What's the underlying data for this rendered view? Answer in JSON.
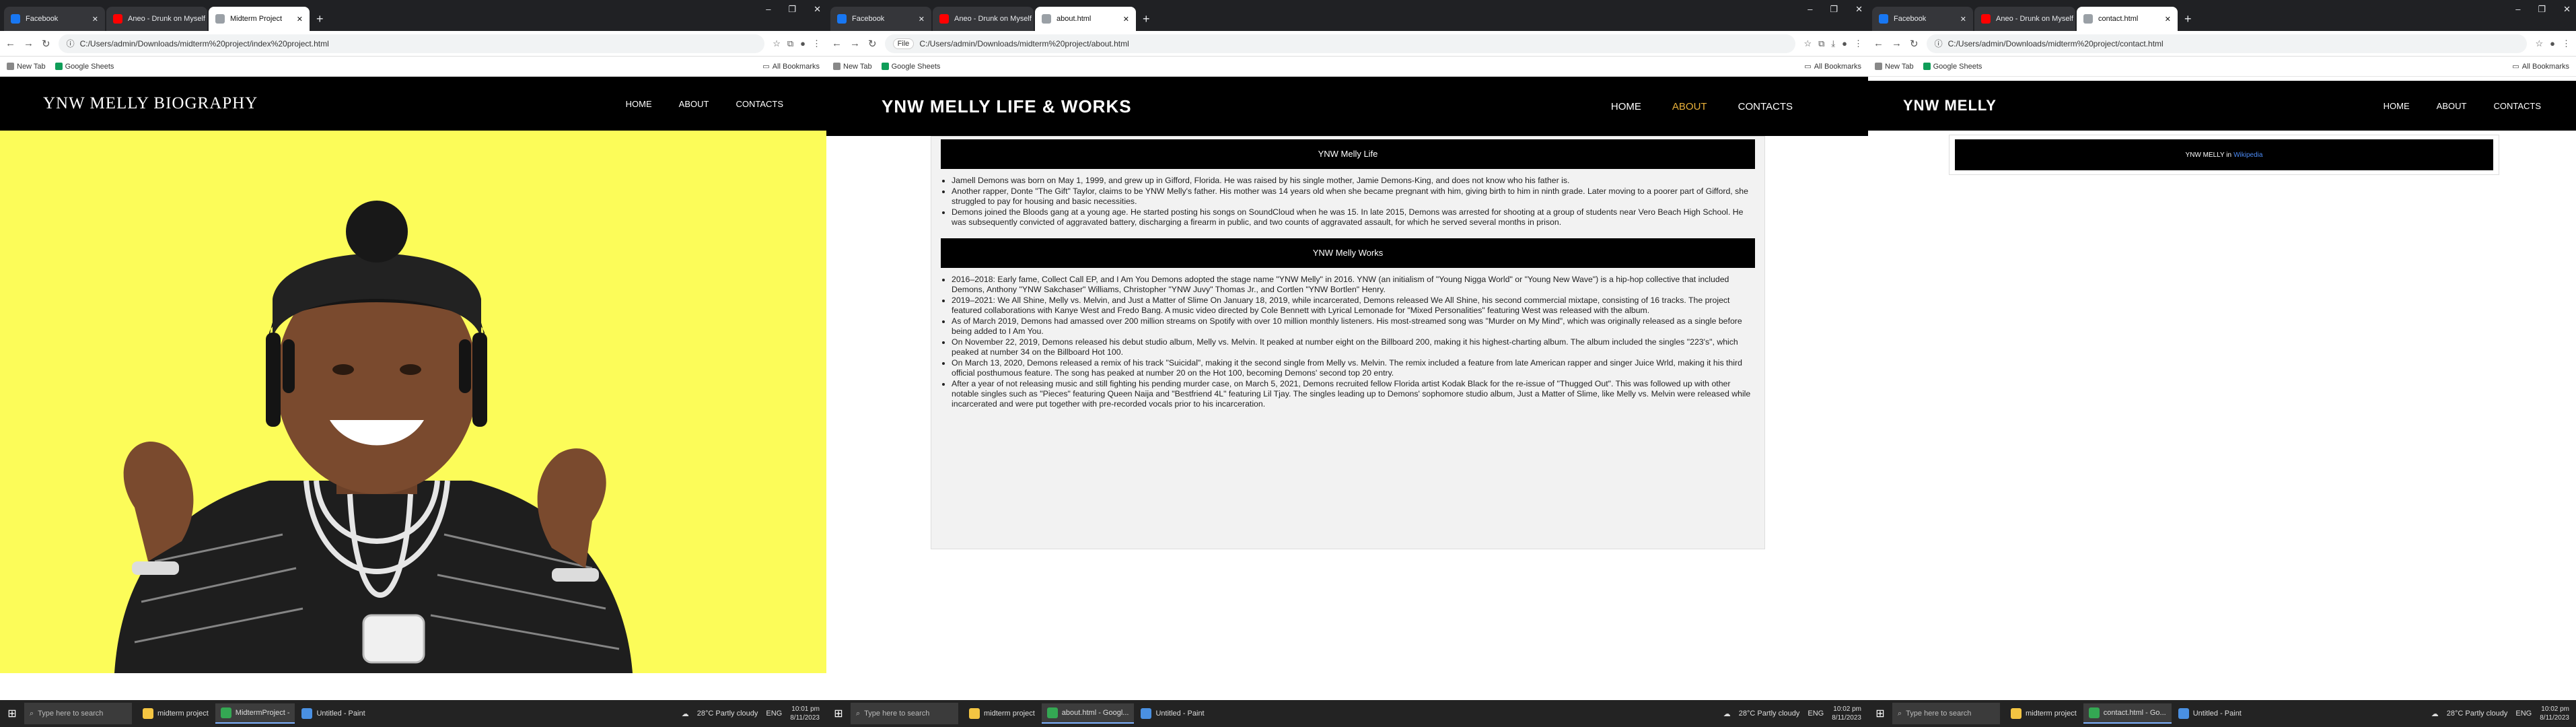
{
  "windows": [
    {
      "tabs": [
        {
          "label": "Facebook",
          "favicon": "facebook-icon"
        },
        {
          "label": "Aneo - Drunk on Myself",
          "favicon": "youtube-icon"
        },
        {
          "label": "Midterm Project",
          "favicon": "document-icon"
        }
      ],
      "address": "C:/Users/admin/Downloads/midterm%20project/index%20project.html",
      "bookmarks": [
        "New Tab",
        "Google Sheets"
      ],
      "all_bookmarks": "All Bookmarks",
      "site": {
        "brand": "YNW Melly Biography",
        "nav": [
          "HOME",
          "ABOUT",
          "CONTACTS"
        ]
      },
      "hero": {
        "background": "#fcfc59",
        "image": "ynw-melly-portrait"
      },
      "taskbar": {
        "search": "Type here to search",
        "apps": [
          "midterm project",
          "MidtermProject -",
          "Untitled - Paint"
        ],
        "weather": "28°C Partly cloudy",
        "lang": "ENG",
        "time": "10:01 pm",
        "date": "8/11/2023"
      }
    },
    {
      "tabs": [
        {
          "label": "Facebook",
          "favicon": "facebook-icon"
        },
        {
          "label": "Aneo - Drunk on Myself",
          "favicon": "youtube-icon"
        },
        {
          "label": "about.html",
          "favicon": "document-icon"
        }
      ],
      "address_badge": "File",
      "address": "C:/Users/admin/Downloads/midterm%20project/about.html",
      "bookmarks": [
        "New Tab",
        "Google Sheets"
      ],
      "all_bookmarks": "All Bookmarks",
      "site": {
        "brand": "YNW Melly Life & Works",
        "nav": [
          "HOME",
          "ABOUT",
          "CONTACTS"
        ],
        "accent": "#e9b13a"
      },
      "sections": [
        {
          "title": "YNW Melly Life",
          "items": [
            "Jamell Demons was born on May 1, 1999, and grew up in Gifford, Florida. He was raised by his single mother, Jamie Demons-King, and does not know who his father is.",
            "Another rapper, Donte \"The Gift\" Taylor, claims to be YNW Melly's father. His mother was 14 years old when she became pregnant with him, giving birth to him in ninth grade. Later moving to a poorer part of Gifford, she struggled to pay for housing and basic necessities.",
            "Demons joined the Bloods gang at a young age. He started posting his songs on SoundCloud when he was 15. In late 2015, Demons was arrested for shooting at a group of students near Vero Beach High School. He was subsequently convicted of aggravated battery, discharging a firearm in public, and two counts of aggravated assault, for which he served several months in prison."
          ]
        },
        {
          "title": "YNW Melly Works",
          "items": [
            "2016–2018: Early fame, Collect Call EP, and I Am You Demons adopted the stage name \"YNW Melly\" in 2016. YNW (an initialism of \"Young Nigga World\" or \"Young New Wave\") is a hip-hop collective that included Demons, Anthony \"YNW Sakchaser\" Williams, Christopher \"YNW Juvy\" Thomas Jr., and Cortlen \"YNW Bortlen\" Henry.",
            "2019–2021: We All Shine, Melly vs. Melvin, and Just a Matter of Slime On January 18, 2019, while incarcerated, Demons released We All Shine, his second commercial mixtape, consisting of 16 tracks. The project featured collaborations with Kanye West and Fredo Bang. A music video directed by Cole Bennett with Lyrical Lemonade for \"Mixed Personalities\" featuring West was released with the album.",
            "As of March 2019, Demons had amassed over 200 million streams on Spotify with over 10 million monthly listeners. His most-streamed song was \"Murder on My Mind\", which was originally released as a single before being added to I Am You.",
            "On November 22, 2019, Demons released his debut studio album, Melly vs. Melvin. It peaked at number eight on the Billboard 200, making it his highest-charting album. The album included the singles \"223's\", which peaked at number 34 on the Billboard Hot 100.",
            "On March 13, 2020, Demons released a remix of his track \"Suicidal\", making it the second single from Melly vs. Melvin. The remix included a feature from late American rapper and singer Juice Wrld, making it his third official posthumous feature. The song has peaked at number 20 on the Hot 100, becoming Demons' second top 20 entry.",
            "After a year of not releasing music and still fighting his pending murder case, on March 5, 2021, Demons recruited fellow Florida artist Kodak Black for the re-issue of \"Thugged Out\". This was followed up with other notable singles such as \"Pieces\" featuring Queen Naija and \"Bestfriend 4L\" featuring Lil Tjay. The singles leading up to Demons' sophomore studio album, Just a Matter of Slime, like Melly vs. Melvin were released while incarcerated and were put together with pre-recorded vocals prior to his incarceration."
          ]
        }
      ],
      "taskbar": {
        "search": "Type here to search",
        "apps": [
          "midterm project",
          "about.html - Googl...",
          "Untitled - Paint"
        ],
        "weather": "28°C Partly cloudy",
        "lang": "ENG",
        "time": "10:02 pm",
        "date": "8/11/2023"
      }
    },
    {
      "tabs": [
        {
          "label": "Facebook",
          "favicon": "facebook-icon"
        },
        {
          "label": "Aneo - Drunk on Myself",
          "favicon": "youtube-icon"
        },
        {
          "label": "contact.html",
          "favicon": "document-icon"
        }
      ],
      "address": "C:/Users/admin/Downloads/midterm%20project/contact.html",
      "bookmarks": [
        "New Tab",
        "Google Sheets"
      ],
      "all_bookmarks": "All Bookmarks",
      "site": {
        "brand": "YNW Melly",
        "nav": [
          "HOME",
          "ABOUT",
          "CONTACTS"
        ]
      },
      "contact": {
        "text": "YNW MELLY in",
        "link": "Wikipedia"
      },
      "taskbar": {
        "search": "Type here to search",
        "apps": [
          "midterm project",
          "contact.html - Go...",
          "Untitled - Paint"
        ],
        "weather": "28°C Partly cloudy",
        "lang": "ENG",
        "time": "10:02 pm",
        "date": "8/11/2023"
      }
    }
  ]
}
